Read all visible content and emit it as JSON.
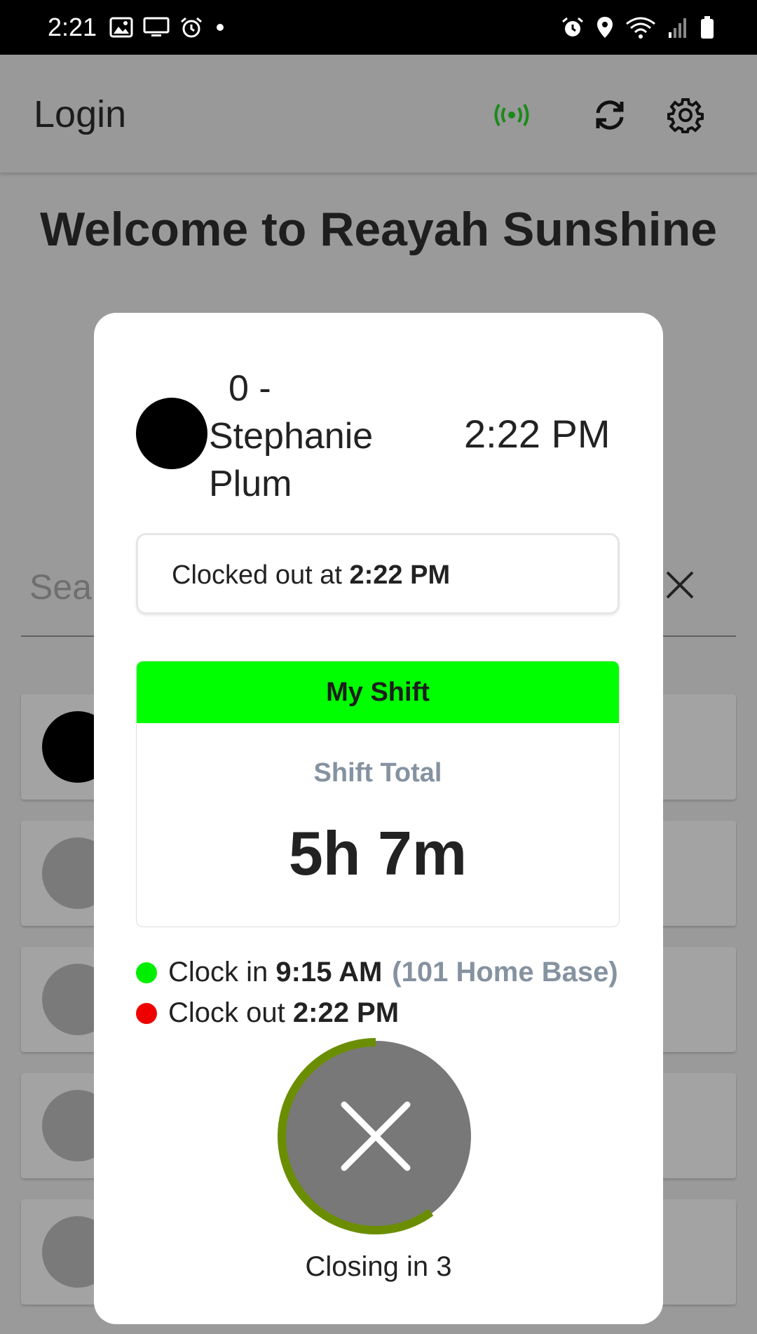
{
  "status_bar": {
    "time": "2:21",
    "left_icons": [
      "image-icon",
      "monitor-icon",
      "alarm-icon",
      "dot-icon"
    ],
    "right_icons": [
      "alarm-icon",
      "location-icon",
      "wifi-icon",
      "signal-icon",
      "battery-icon"
    ]
  },
  "app_bar": {
    "title": "Login",
    "broadcast_color": "#1a8a1a",
    "actions": [
      "broadcast-icon",
      "sync-icon",
      "settings-icon"
    ]
  },
  "welcome_text": "Welcome to Reayah Sunshine",
  "search": {
    "placeholder_visible": "Sea"
  },
  "modal": {
    "employee_number": "0 -",
    "employee_first": "Stephanie",
    "employee_last": "Plum",
    "time": "2:22 PM",
    "status_prefix": "Clocked out at",
    "status_time": "2:22 PM",
    "shift": {
      "header": "My Shift",
      "header_color": "#00ff00",
      "total_label": "Shift Total",
      "total_value": "5h 7m"
    },
    "punches": [
      {
        "label": "Clock in",
        "time": "9:15 AM",
        "location": "(101 Home Base)",
        "color": "#00ee00"
      },
      {
        "label": "Clock out",
        "time": "2:22 PM",
        "location": "",
        "color": "#ee0000"
      }
    ],
    "close_progress": 0.6,
    "progress_color": "#6b8e00",
    "closing_text": "Closing in 3"
  }
}
